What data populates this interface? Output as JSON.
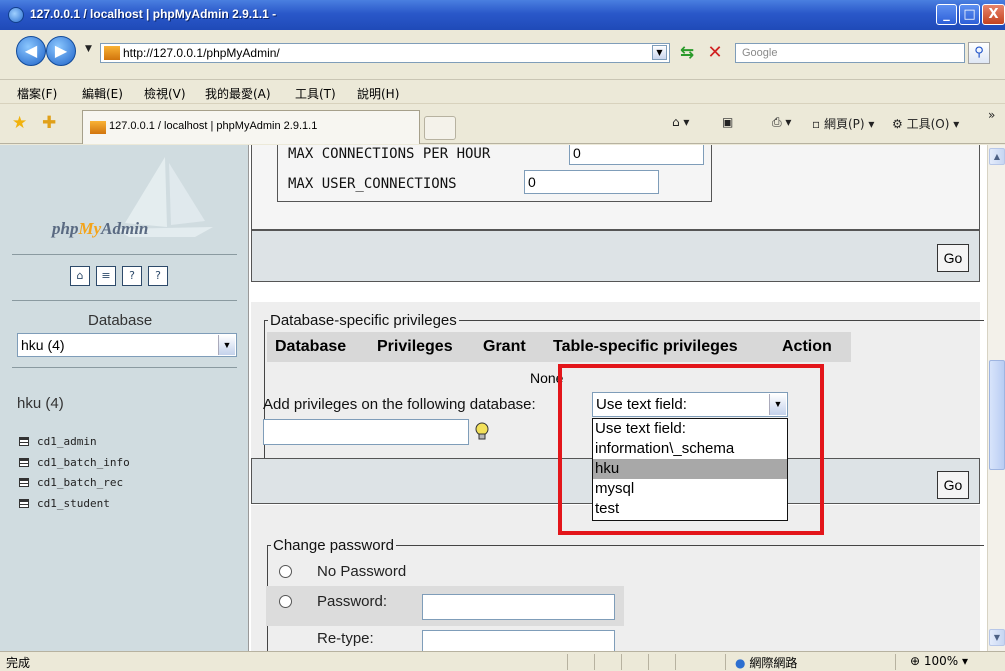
{
  "window": {
    "title": "127.0.0.1 / localhost | phpMyAdmin 2.9.1.1 -",
    "minimize": "_",
    "maximize": "□",
    "close": "X"
  },
  "address_bar": {
    "url": "http://127.0.0.1/phpMyAdmin/",
    "search_placeholder": "Google"
  },
  "menu": [
    "檔案(F)",
    "編輯(E)",
    "檢視(V)",
    "我的最愛(A)",
    "工具(T)",
    "說明(H)"
  ],
  "tabs": {
    "active_title": "127.0.0.1 / localhost | phpMyAdmin 2.9.1.1"
  },
  "command_bar": {
    "page_label": "網頁(P)",
    "tools_label": "工具(O)"
  },
  "left_frame": {
    "logo": {
      "prefix": "php",
      "highlight": "My",
      "suffix": "Admin"
    },
    "database_label": "Database",
    "database_select": "hku (4)",
    "db_heading": "hku (4)",
    "tables": [
      "cd1_admin",
      "cd1_batch_info",
      "cd1_batch_rec",
      "cd1_student"
    ]
  },
  "resource_limits": {
    "max_connections_per_hour_label": "MAX CONNECTIONS PER HOUR",
    "max_connections_per_hour_value": "0",
    "max_user_connections_label": "MAX USER_CONNECTIONS",
    "max_user_connections_value": "0"
  },
  "go_label": "Go",
  "db_privileges": {
    "legend": "Database-specific privileges",
    "columns": [
      "Database",
      "Privileges",
      "Grant",
      "Table-specific privileges",
      "Action"
    ],
    "empty_text": "None",
    "add_label": "Add privileges on the following database:",
    "select_value": "Use text field:",
    "options": [
      "Use text field:",
      "information\\_schema",
      "hku",
      "mysql",
      "test"
    ],
    "selected_option": "hku",
    "highlight_color": "#e3151a"
  },
  "change_password": {
    "legend": "Change password",
    "no_password": "No Password",
    "password": "Password:",
    "retype": "Re-type:"
  },
  "status_bar": {
    "text": "完成",
    "zone": "網際網路",
    "zoom": "100%"
  }
}
